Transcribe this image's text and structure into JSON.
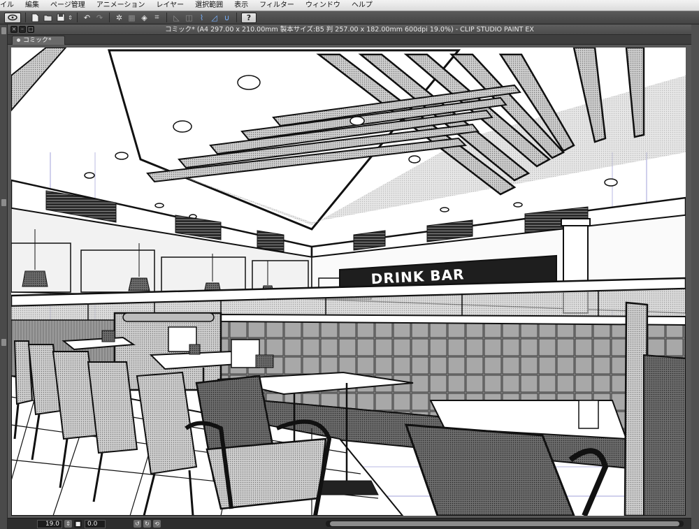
{
  "menubar": {
    "items": [
      "イル",
      "編集",
      "ページ管理",
      "アニメーション",
      "レイヤー",
      "選択範囲",
      "表示",
      "フィルター",
      "ウィンドウ",
      "ヘルプ"
    ]
  },
  "toolbar": {
    "icons": [
      "clip-studio-icon",
      "new-file-icon",
      "open-file-icon",
      "save-icon",
      "undo-icon",
      "redo-icon",
      "transform-icon",
      "help-icon"
    ],
    "help_label": "?"
  },
  "document": {
    "title": "コミック* (A4 297.00 x 210.00mm 製本サイズ:B5 判 257.00 x 182.00mm 600dpi 19.0%) - CLIP STUDIO PAINT EX",
    "tab_label": "コミック*",
    "sign_text": "DRINK BAR"
  },
  "statusbar": {
    "zoom": "19.0",
    "rotation": "0.0"
  },
  "colors": {
    "menubar_bg": "#e6e6e6",
    "chrome_dark": "#4c4c4c",
    "canvas_bg": "#585858",
    "accent_blue": "#7ab3ff"
  }
}
